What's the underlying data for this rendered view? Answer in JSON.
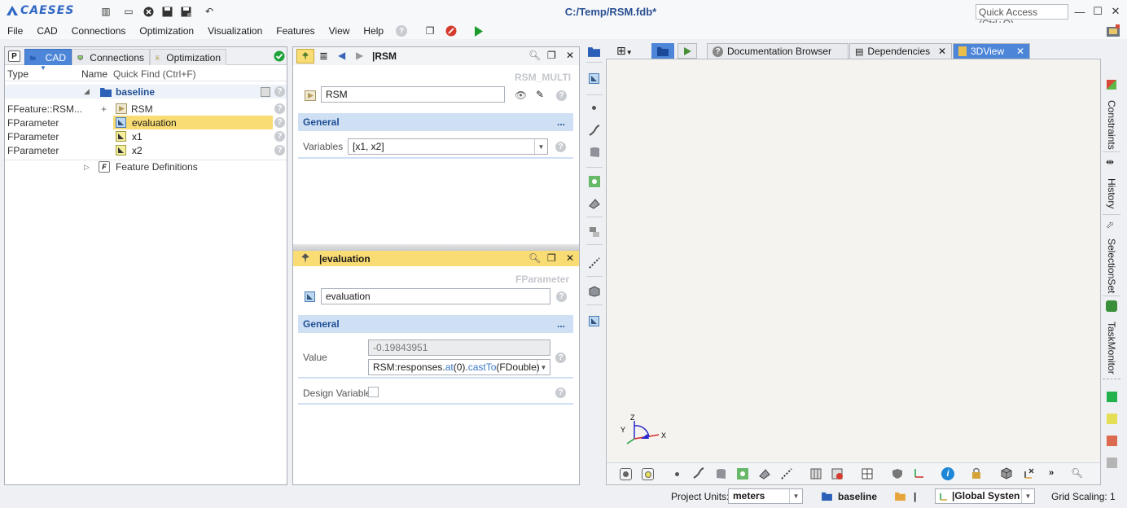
{
  "app": {
    "logo_text": "CAESES",
    "title": "C:/Temp/RSM.fdb*"
  },
  "toolbar": {
    "quick_access_placeholder": "Quick Access (Ctrl+Q)"
  },
  "menu": [
    "File",
    "CAD",
    "Connections",
    "Optimization",
    "Visualization",
    "Features",
    "View",
    "Help"
  ],
  "left_panel": {
    "p_label": "P",
    "tabs": [
      {
        "label": "CAD",
        "icon": "folder-icon",
        "active": true
      },
      {
        "label": "Connections",
        "icon": "monitor-icon",
        "active": false
      },
      {
        "label": "Optimization",
        "icon": "play-icon",
        "active": false
      }
    ],
    "columns": {
      "type": "Type",
      "name": "Name"
    },
    "quick_find_placeholder": "Quick Find (Ctrl+F)",
    "tree": [
      {
        "type": "",
        "name": "baseline",
        "icon": "folder-icon",
        "bold": true
      },
      {
        "type": "FFeature::RSM...",
        "name": "RSM",
        "icon": "feature-icon"
      },
      {
        "type": "FParameter",
        "name": "evaluation",
        "icon": "parameter-icon",
        "selected": true
      },
      {
        "type": "FParameter",
        "name": "x1",
        "icon": "parameter-icon"
      },
      {
        "type": "FParameter",
        "name": "x2",
        "icon": "parameter-icon"
      },
      {
        "type": "",
        "name": "Feature Definitions",
        "icon": "feature-definitions-icon"
      }
    ]
  },
  "rsm_panel": {
    "title": "|RSM",
    "type_label": "RSM_MULTI",
    "name_value": "RSM",
    "section": "General",
    "section_more": "...",
    "variables_label": "Variables",
    "variables_value": "[x1, x2]"
  },
  "eval_panel": {
    "title": "|evaluation",
    "type_label": "FParameter",
    "name_value": "evaluation",
    "section": "General",
    "section_more": "...",
    "value_label": "Value",
    "value_result": "-0.19843951",
    "expression_parts": [
      {
        "text": "RSM:responses.",
        "color": "#222222"
      },
      {
        "text": "at",
        "color": "#3a78c9"
      },
      {
        "text": "(0).",
        "color": "#222222"
      },
      {
        "text": "castTo",
        "color": "#3a78c9"
      },
      {
        "text": "(FDouble)",
        "color": "#222222"
      }
    ],
    "design_variable_label": "Design Variable"
  },
  "view_tabs": [
    {
      "label": "Documentation Browser",
      "active": false
    },
    {
      "label": "Dependencies",
      "active": false
    },
    {
      "label": "3DView",
      "active": true
    }
  ],
  "axes": {
    "x": "X",
    "y": "Y",
    "z": "Z"
  },
  "right_dock": [
    "Constraints",
    "History",
    "SelectionSet",
    "TaskMonitor"
  ],
  "dock_colors": [
    "#22b14c",
    "#e4df55",
    "#dc6a4e",
    "#b5b5b5"
  ],
  "status": {
    "units_label": "Project Units:",
    "units_value": "meters",
    "design": "baseline",
    "folder_value": "|",
    "coord_system": "|Global Systen",
    "grid_scaling": "Grid Scaling: 1"
  }
}
